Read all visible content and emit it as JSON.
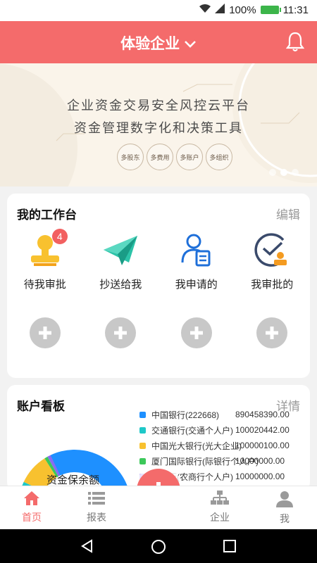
{
  "status": {
    "battery": "100%",
    "time": "11:31"
  },
  "header": {
    "title": "体验企业",
    "accent": "#f46b6b"
  },
  "banner": {
    "line1": "企业资金交易安全风控云平台",
    "line2": "资金管理数字化和决策工具",
    "tags": [
      "多股东",
      "多费用",
      "多账户",
      "多组织"
    ]
  },
  "workbench": {
    "title": "我的工作台",
    "edit": "编辑",
    "items": [
      {
        "label": "待我审批",
        "icon": "stamp-icon",
        "badge": "4"
      },
      {
        "label": "抄送给我",
        "icon": "paper-plane-icon"
      },
      {
        "label": "我申请的",
        "icon": "user-form-icon"
      },
      {
        "label": "我审批的",
        "icon": "approved-check-icon"
      }
    ]
  },
  "accounts": {
    "title": "账户看板",
    "detail": "详情",
    "donut_label": "资金保余额",
    "chart_data": {
      "type": "pie",
      "series": [
        {
          "name": "中国银行(222668)",
          "value": "890458390.00",
          "color": "#1e90ff"
        },
        {
          "name": "交通银行(交通个人户)",
          "value": "100020442.00",
          "color": "#1ec8c8"
        },
        {
          "name": "中国光大银行(光大企业)",
          "value": "100000100.00",
          "color": "#f8c12f"
        },
        {
          "name": "厦门国际银行(际银行个人户)",
          "value": "10000000.00",
          "color": "#3cc85a"
        },
        {
          "name": "商银行(农商行个人户)",
          "value": "10000000.00",
          "color": "#8a6cf0"
        }
      ]
    }
  },
  "nav": {
    "items": [
      {
        "label": "首页",
        "icon": "home-icon"
      },
      {
        "label": "报表",
        "icon": "list-icon"
      },
      {
        "label": "企业",
        "icon": "org-icon"
      },
      {
        "label": "我",
        "icon": "person-icon"
      }
    ]
  }
}
